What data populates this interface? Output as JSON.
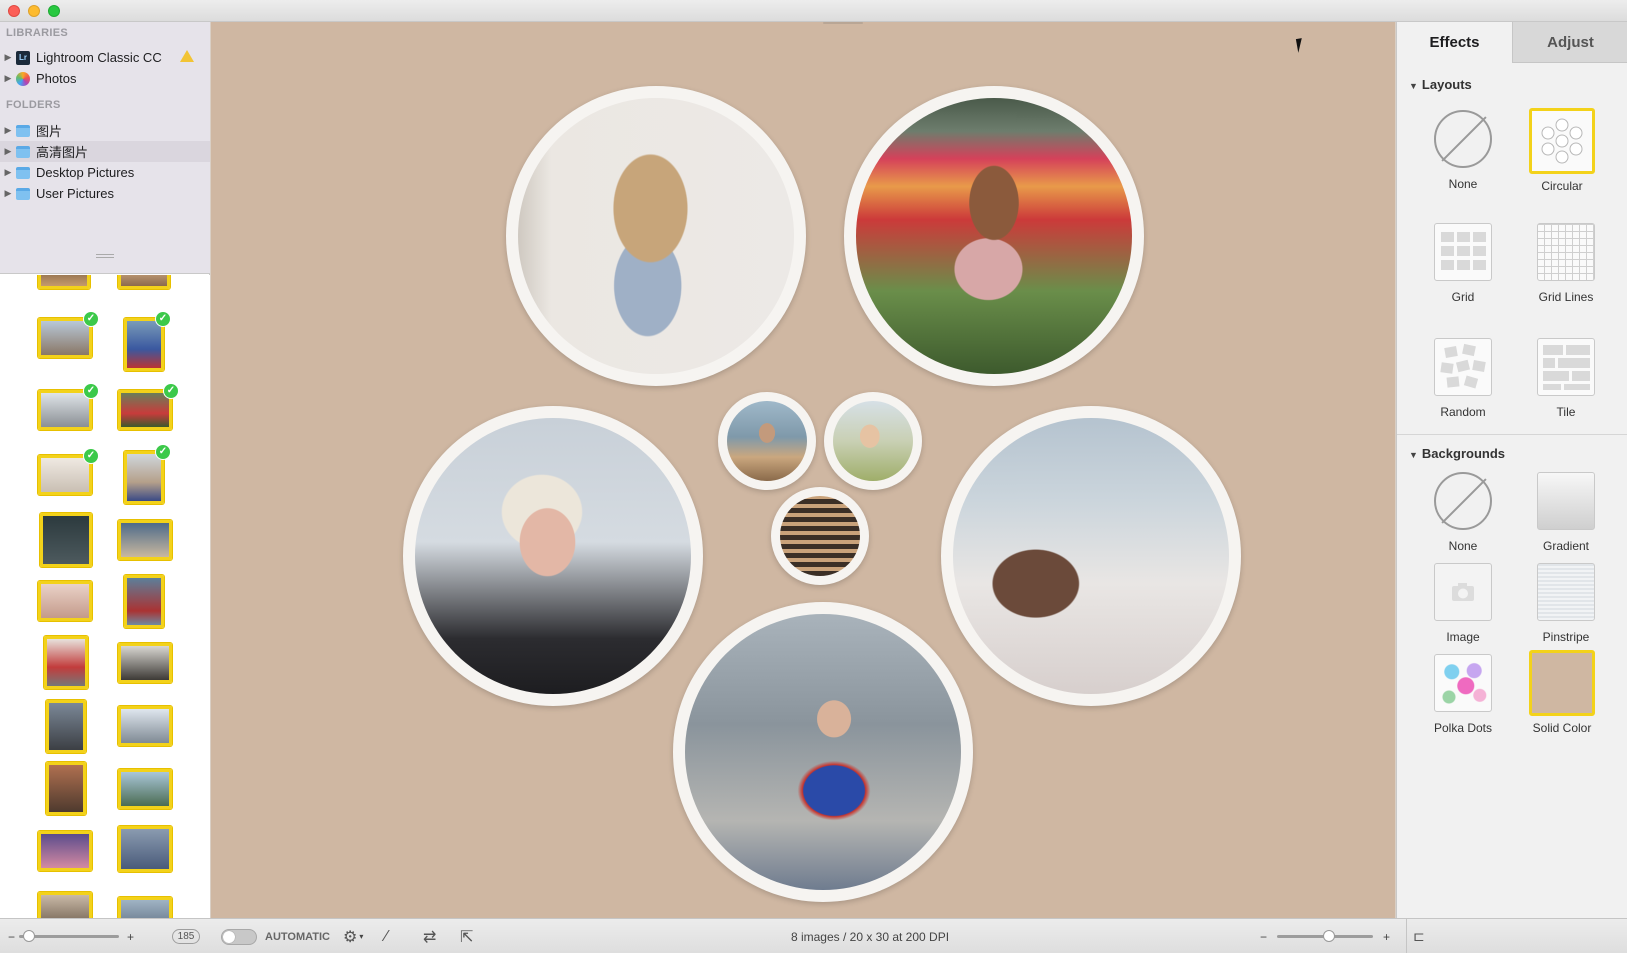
{
  "sidebar": {
    "libraries_header": "LIBRARIES",
    "libraries": [
      {
        "label": "Lightroom Classic CC",
        "icon": "lightroom-icon",
        "icon_text": "Lr",
        "warning": true
      },
      {
        "label": "Photos",
        "icon": "photos-icon"
      }
    ],
    "folders_header": "FOLDERS",
    "folders": [
      {
        "label": "图片",
        "selected": false
      },
      {
        "label": "高清图片",
        "selected": true
      },
      {
        "label": "Desktop Pictures",
        "selected": false
      },
      {
        "label": "User Pictures",
        "selected": false
      }
    ]
  },
  "inspector": {
    "tabs": [
      {
        "label": "Effects",
        "active": true
      },
      {
        "label": "Adjust",
        "active": false
      }
    ],
    "layouts_header": "Layouts",
    "layouts": [
      {
        "label": "None",
        "selected": false
      },
      {
        "label": "Circular",
        "selected": true
      },
      {
        "label": "Grid",
        "selected": false
      },
      {
        "label": "Grid Lines",
        "selected": false
      },
      {
        "label": "Random",
        "selected": false
      },
      {
        "label": "Tile",
        "selected": false
      }
    ],
    "backgrounds_header": "Backgrounds",
    "backgrounds": [
      {
        "label": "None",
        "selected": false
      },
      {
        "label": "Gradient",
        "selected": false
      },
      {
        "label": "Image",
        "selected": false
      },
      {
        "label": "Pinstripe",
        "selected": false
      },
      {
        "label": "Polka Dots",
        "selected": false
      },
      {
        "label": "Solid Color",
        "selected": true
      }
    ],
    "solid_color": "#cfb7a2"
  },
  "bottombar": {
    "thumb_count": "185",
    "auto_label": "AUTOMATIC",
    "status": "8 images / 20 x 30 at 200 DPI",
    "minus": "−",
    "plus": "+"
  },
  "colors": {
    "canvas_bg": "#cfb7a2",
    "selection": "#f3d21a",
    "check": "#3cc94a"
  }
}
